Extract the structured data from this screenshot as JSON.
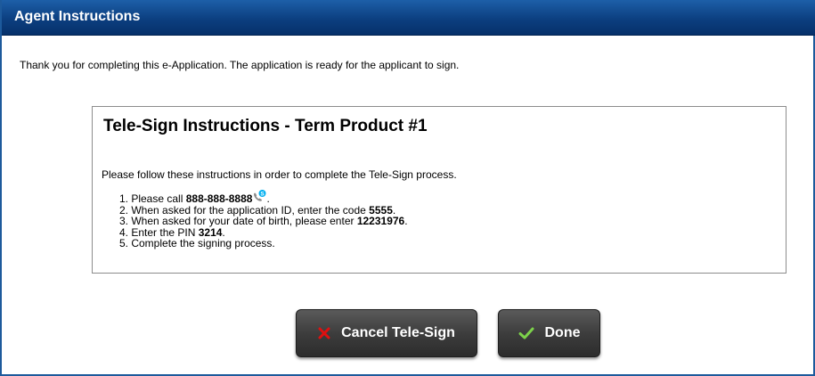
{
  "window": {
    "title": "Agent Instructions"
  },
  "intro_text": "Thank you for completing this e-Application. The application is ready for the applicant to sign.",
  "panel": {
    "heading": "Tele-Sign Instructions - Term Product #1",
    "description": "Please follow these instructions in order to complete the Tele-Sign process.",
    "steps": {
      "s1_prefix": "1. Please call ",
      "s1_phone": "888-888-8888",
      "s1_suffix": ".",
      "s2_prefix": "2. When asked for the application ID, enter the code ",
      "s2_code": "5555",
      "s2_suffix": ".",
      "s3_prefix": "3. When asked for your date of birth, please enter ",
      "s3_dob": "12231976",
      "s3_suffix": ".",
      "s4_prefix": "4. Enter the PIN ",
      "s4_pin": "3214",
      "s4_suffix": ".",
      "s5": "5. Complete the signing process."
    }
  },
  "buttons": {
    "cancel_label": "Cancel Tele-Sign",
    "done_label": "Done"
  },
  "icons": {
    "cancel": "x-icon",
    "done": "checkmark-icon",
    "phone": "skype-phone-icon"
  },
  "colors": {
    "titlebar": "#0c3f80",
    "cancel_icon": "#e01010",
    "done_icon": "#7cd24a",
    "skype_icon": "#00aff0"
  }
}
